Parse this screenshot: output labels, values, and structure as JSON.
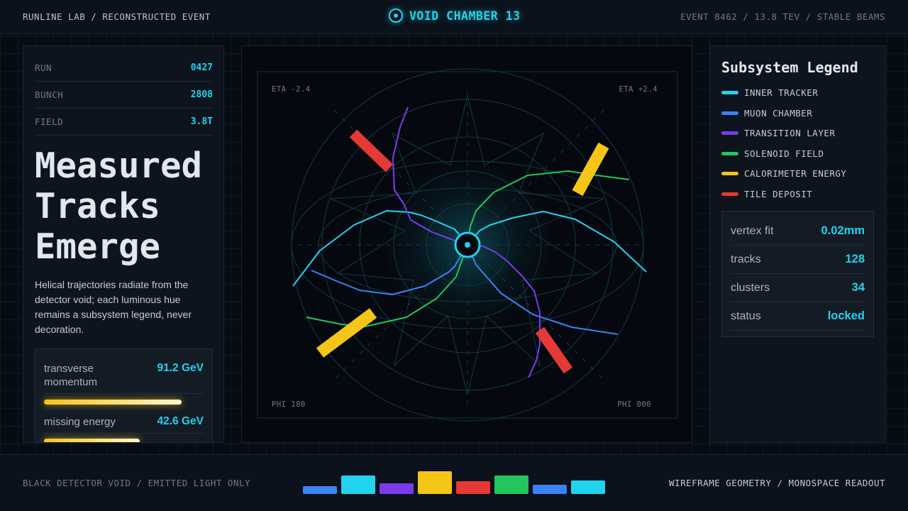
{
  "header": {
    "breadcrumb": "RUNLINE LAB / RECONSTRUCTED EVENT",
    "title": "VOID CHAMBER 13",
    "title_icon": "target-icon",
    "event_info": "EVENT 8462 / 13.8 TEV / STABLE BEAMS"
  },
  "left": {
    "meta": [
      {
        "key": "RUN",
        "value": "0427"
      },
      {
        "key": "BUNCH",
        "value": "2808"
      },
      {
        "key": "FIELD",
        "value": "3.8T"
      }
    ],
    "headline": [
      "Measured",
      "Tracks",
      "Emerge"
    ],
    "blurb": "Helical trajectories radiate from the detector void; each luminous hue remains a subsystem legend, never decoration.",
    "metrics": [
      {
        "label": "transverse momentum",
        "value": "91.2 GeV",
        "fill": 0.86
      },
      {
        "label": "missing energy",
        "value": "42.6 GeV",
        "fill": 0.6
      }
    ]
  },
  "display": {
    "corner_labels": {
      "top_left": "ETA -2.4",
      "top_right": "ETA +2.4",
      "bottom_left": "PHI 180",
      "bottom_right": "PHI 000"
    }
  },
  "legend": {
    "title": "Subsystem Legend",
    "items": [
      {
        "label": "INNER TRACKER",
        "color": "#22d3ee"
      },
      {
        "label": "MUON CHAMBER",
        "color": "#3b82f6"
      },
      {
        "label": "TRANSITION LAYER",
        "color": "#7c3aed"
      },
      {
        "label": "SOLENOID FIELD",
        "color": "#22c55e"
      },
      {
        "label": "CALORIMETER ENERGY",
        "color": "#f5c518"
      },
      {
        "label": "TILE DEPOSIT",
        "color": "#e53935"
      }
    ],
    "stats": [
      {
        "key": "vertex fit",
        "value": "0.02mm"
      },
      {
        "key": "tracks",
        "value": "128"
      },
      {
        "key": "clusters",
        "value": "34"
      },
      {
        "key": "status",
        "value": "locked"
      }
    ]
  },
  "footer": {
    "left": "BLACK DETECTOR VOID / EMITTED LIGHT ONLY",
    "right": "WIREFRAME GEOMETRY / MONOSPACE READOUT",
    "strip": [
      {
        "color": "#3b82f6",
        "level": 0.2
      },
      {
        "color": "#22d3ee",
        "level": 0.75
      },
      {
        "color": "#7c3aed",
        "level": 0.35
      },
      {
        "color": "#f5c518",
        "level": 1.0
      },
      {
        "color": "#e53935",
        "level": 0.45
      },
      {
        "color": "#22c55e",
        "level": 0.75
      },
      {
        "color": "#3b82f6",
        "level": 0.25
      },
      {
        "color": "#22d3ee",
        "level": 0.5
      }
    ]
  }
}
